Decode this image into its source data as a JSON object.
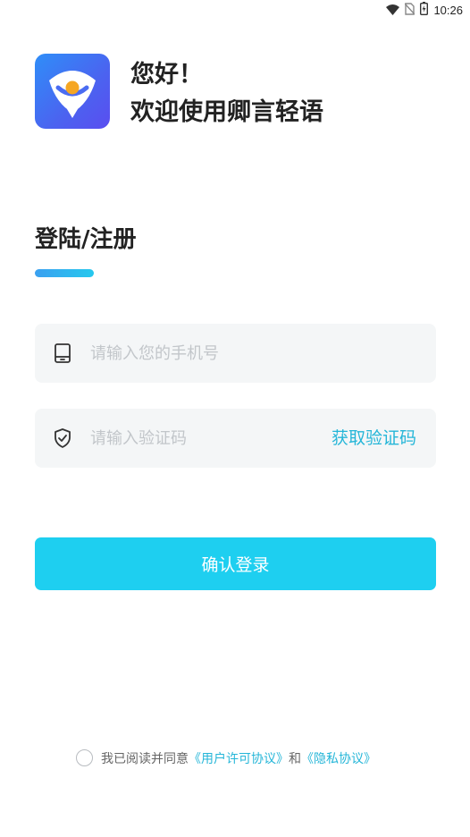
{
  "status_bar": {
    "time": "10:26",
    "icons": [
      "wifi-icon",
      "no-sim-icon",
      "battery-icon"
    ]
  },
  "header": {
    "greeting_line1": "您好！",
    "greeting_line2": "欢迎使用卿言轻语",
    "logo_colors": [
      "#2f8ef8",
      "#5a4df0"
    ],
    "logo_accent": "#f5a623"
  },
  "login": {
    "title": "登陆/注册",
    "accent_color": "#26c8ee",
    "phone": {
      "placeholder": "请输入您的手机号",
      "value": "",
      "icon": "phone-icon"
    },
    "code": {
      "placeholder": "请输入验证码",
      "value": "",
      "icon": "shield-check-icon",
      "get_code_label": "获取验证码"
    },
    "submit_label": "确认登录",
    "submit_color": "#1ecff0"
  },
  "agreement": {
    "checked": false,
    "prefix": "我已阅读并同意",
    "user_license_link": "《用户许可协议》",
    "conjunction": "和",
    "privacy_link": "《隐私协议》",
    "link_color": "#25b6d8"
  }
}
